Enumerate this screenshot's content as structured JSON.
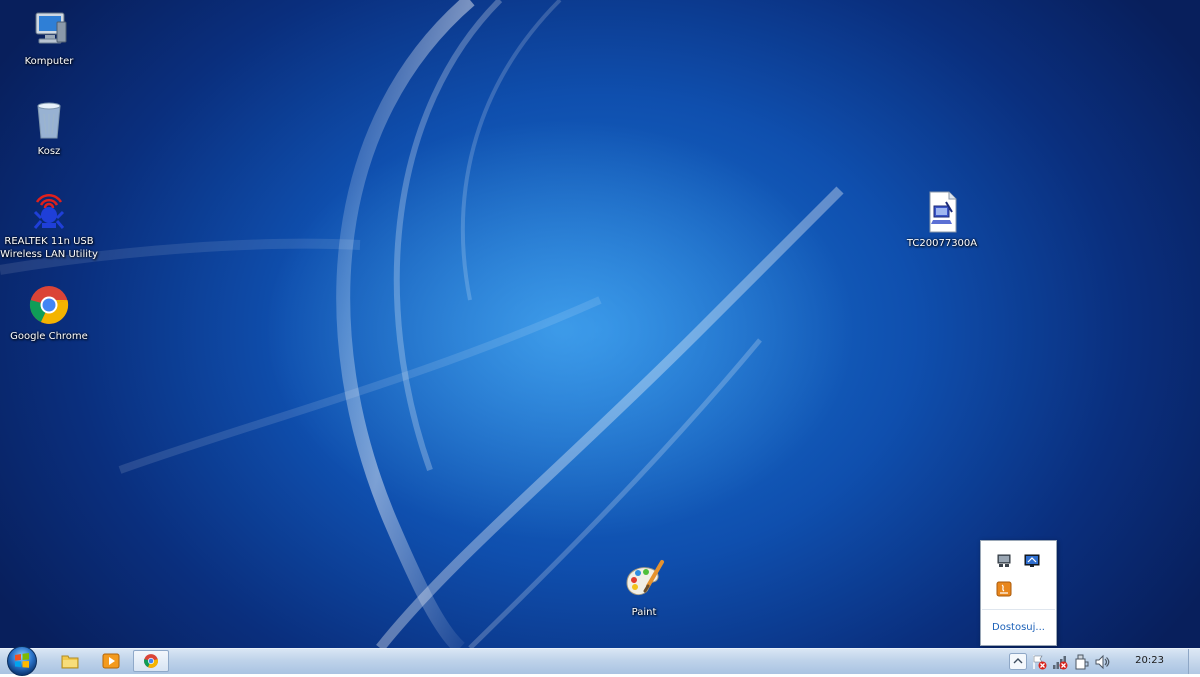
{
  "desktop": {
    "icons": [
      {
        "label": "Komputer",
        "icon": "computer-icon"
      },
      {
        "label": "Kosz",
        "icon": "recycle-bin-icon"
      },
      {
        "label_line1": "REALTEK 11n USB",
        "label_line2": "Wireless LAN Utility",
        "icon": "realtek-wlan-icon"
      },
      {
        "label": "Google Chrome",
        "icon": "chrome-icon"
      },
      {
        "label": "TC20077300A",
        "icon": "document-file-icon"
      },
      {
        "label": "Paint",
        "icon": "paint-icon"
      }
    ]
  },
  "tray_popup": {
    "customize_label": "Dostosuj..."
  },
  "taskbar": {
    "pinned": [
      "windows-explorer-icon",
      "media-player-icon",
      "chrome-icon"
    ],
    "clock": "20:23"
  },
  "colors": {
    "desktop_base": "#0f4fae",
    "taskbar": "#bfd3ea",
    "link": "#1c61b8"
  }
}
